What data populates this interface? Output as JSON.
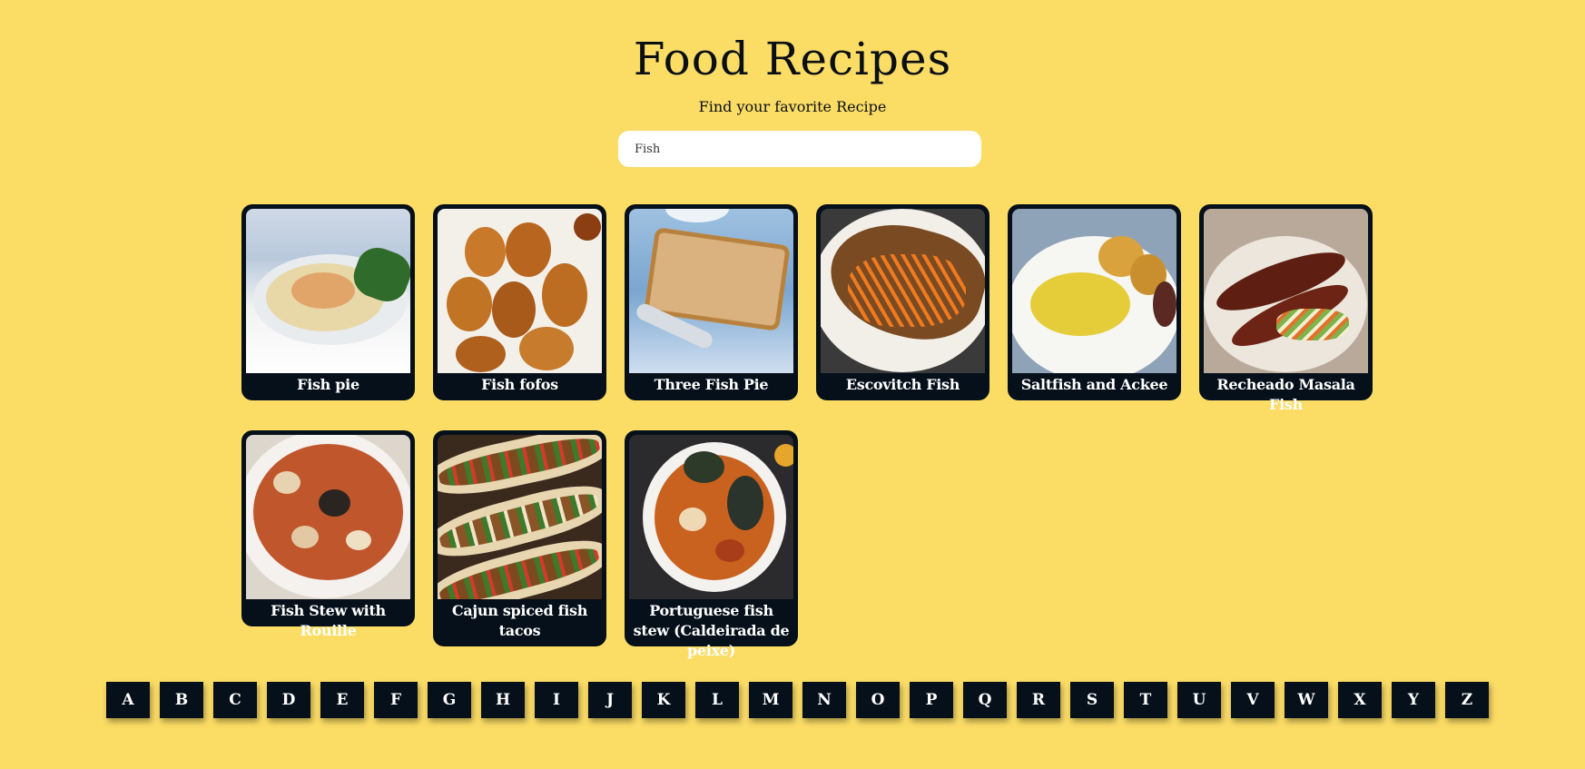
{
  "header": {
    "title": "Food Recipes",
    "subtitle": "Find your favorite Recipe"
  },
  "search": {
    "value": "Fish",
    "placeholder": ""
  },
  "recipes": [
    {
      "name": "Fish pie",
      "image": "fish-pie-photo"
    },
    {
      "name": "Fish fofos",
      "image": "fish-fofos-photo"
    },
    {
      "name": "Three Fish Pie",
      "image": "three-fish-pie-photo"
    },
    {
      "name": "Escovitch Fish",
      "image": "escovitch-fish-photo"
    },
    {
      "name": "Saltfish and Ackee",
      "image": "saltfish-ackee-photo"
    },
    {
      "name": "Recheado Masala Fish",
      "image": "recheado-masala-fish-photo"
    },
    {
      "name": "Fish Stew with Rouille",
      "image": "fish-stew-rouille-photo"
    },
    {
      "name": "Cajun spiced fish tacos",
      "image": "cajun-fish-tacos-photo"
    },
    {
      "name": "Portuguese fish stew (Caldeirada de peixe)",
      "image": "portuguese-fish-stew-photo"
    }
  ],
  "alphabet": [
    "A",
    "B",
    "C",
    "D",
    "E",
    "F",
    "G",
    "H",
    "I",
    "J",
    "K",
    "L",
    "M",
    "N",
    "O",
    "P",
    "Q",
    "R",
    "S",
    "T",
    "U",
    "V",
    "W",
    "X",
    "Y",
    "Z"
  ],
  "colors": {
    "background": "#fbdc65",
    "card": "#06101a",
    "card_text": "#ffffff",
    "letter_button": "#06101a"
  }
}
